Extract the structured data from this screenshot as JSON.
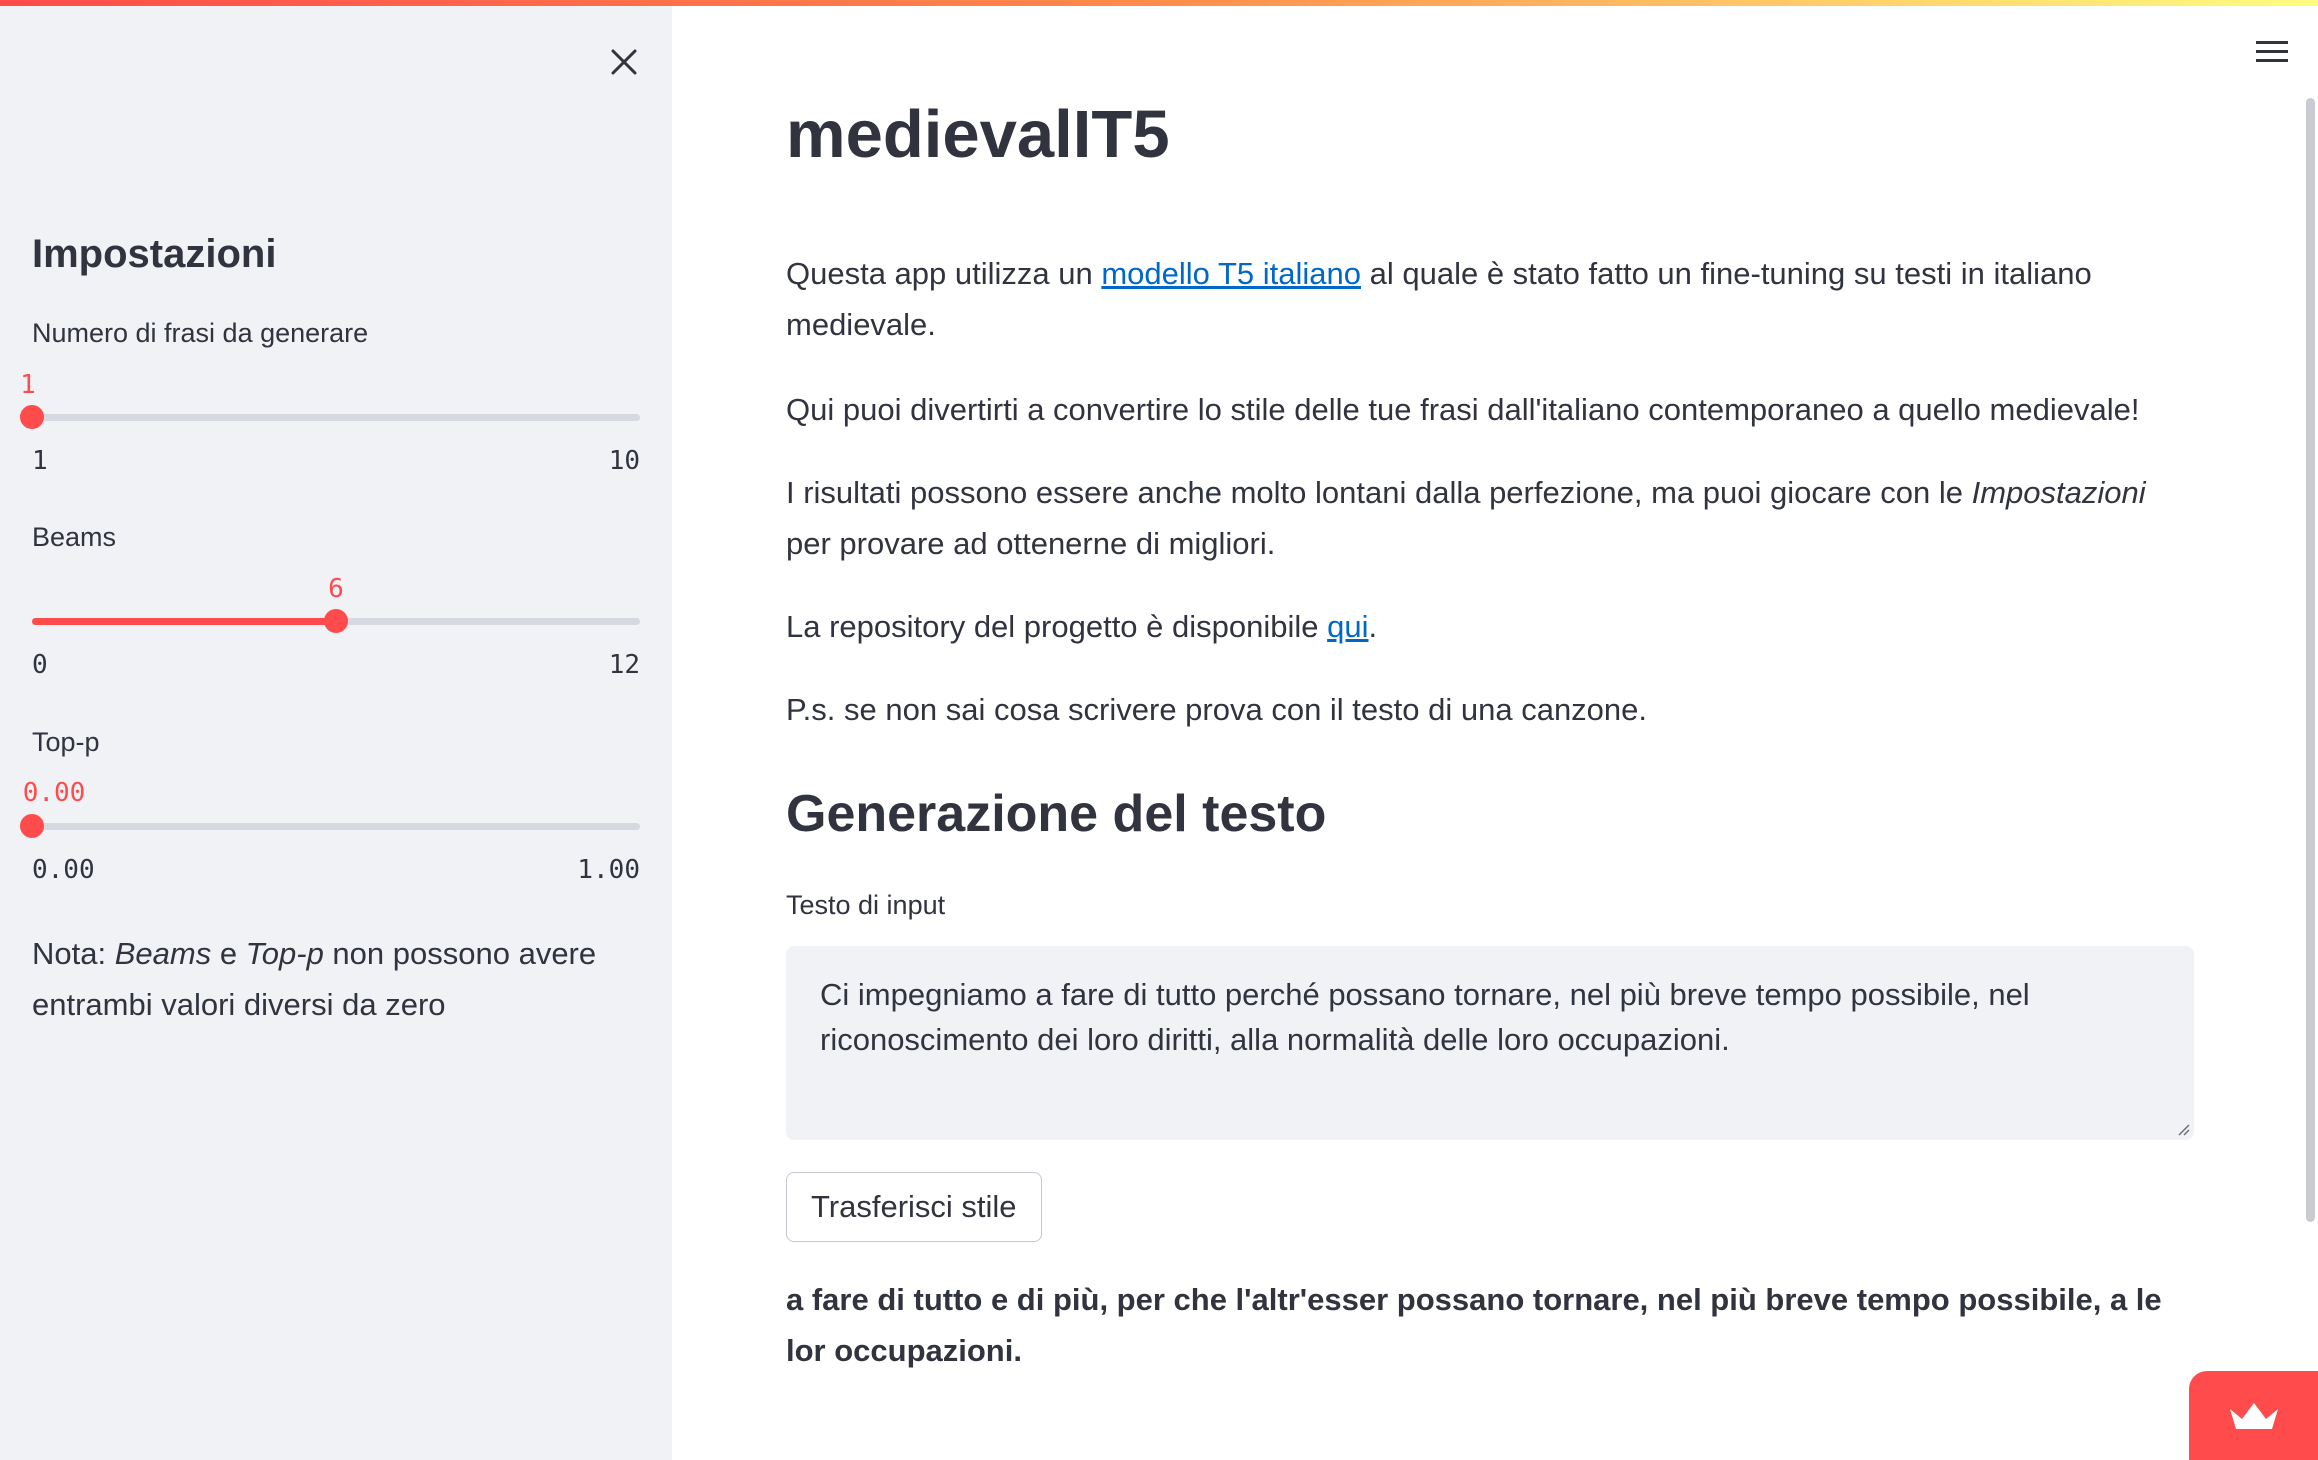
{
  "sidebar": {
    "title": "Impostazioni",
    "sliders": [
      {
        "label": "Numero di frasi da generare",
        "value": "1",
        "min": "1",
        "max": "10",
        "value_num": 1,
        "min_num": 1,
        "max_num": 10
      },
      {
        "label": "Beams",
        "value": "6",
        "min": "0",
        "max": "12",
        "value_num": 6,
        "min_num": 0,
        "max_num": 12
      },
      {
        "label": "Top-p",
        "value": "0.00",
        "min": "0.00",
        "max": "1.00",
        "value_num": 0,
        "min_num": 0,
        "max_num": 1
      }
    ],
    "note": {
      "prefix": "Nota: ",
      "em1": "Beams",
      "mid": " e ",
      "em2": "Top-p",
      "suffix": " non possono avere entrambi valori diversi da zero"
    }
  },
  "main": {
    "title": "medievalIT5",
    "p1": {
      "before": "Questa app utilizza un ",
      "link": "modello T5 italiano",
      "after": " al quale è stato fatto un fine-tuning su testi in italiano medievale."
    },
    "p2": "Qui puoi divertirti a convertire lo stile delle tue frasi dall'italiano contemporaneo a quello medievale!",
    "p3": {
      "before": "I risultati possono essere anche molto lontani dalla perfezione, ma puoi giocare con le ",
      "em": "Impostazioni",
      "after": " per provare ad ottenerne di migliori."
    },
    "p4": {
      "before": "La repository del progetto è disponibile ",
      "link": "qui",
      "after": "."
    },
    "p5": "P.s. se non sai cosa scrivere prova con il testo di una canzone.",
    "section_title": "Generazione del testo",
    "input_label": "Testo di input",
    "input_value": "Ci impegniamo a fare di tutto perché possano tornare, nel più breve tempo possibile, nel riconoscimento dei loro diritti, alla normalità delle loro occupazioni.",
    "button_label": "Trasferisci stile",
    "output": "a fare di tutto e di più, per che l'altr'esser possano tornare, nel più breve tempo possibile, a le lor occupazioni."
  },
  "icons": {
    "close": "close-icon",
    "menu": "hamburger-menu-icon",
    "badge": "crown-icon"
  },
  "colors": {
    "accent": "#ff4b4b",
    "link": "#0068c9",
    "sidebar_bg": "#f0f2f6",
    "text": "#31333f"
  }
}
